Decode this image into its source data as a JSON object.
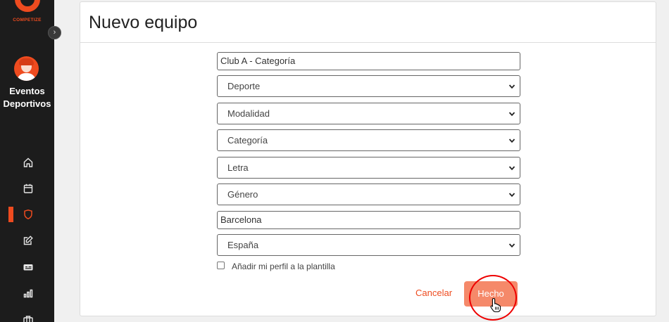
{
  "sidebar": {
    "logo_text": "COMPETIZE",
    "toggle_glyph": "›",
    "org_name": "Eventos Deportivos",
    "accent_color": "#ee4b1f",
    "nav_items": [
      {
        "icon": "home-icon",
        "active": false
      },
      {
        "icon": "calendar-icon",
        "active": false
      },
      {
        "icon": "shield-icon",
        "active": true
      },
      {
        "icon": "edit-icon",
        "active": false
      },
      {
        "icon": "ticket-icon",
        "active": false
      },
      {
        "icon": "stats-icon",
        "active": false
      },
      {
        "icon": "briefcase-icon",
        "active": false
      }
    ]
  },
  "card": {
    "title": "Nuevo equipo"
  },
  "form": {
    "team_name": "Club A - Categoría",
    "deporte": "Deporte",
    "modalidad": "Modalidad",
    "categoria": "Categoría",
    "letra": "Letra",
    "genero": "Género",
    "city": "Barcelona",
    "country": "España",
    "add_profile_label": "Añadir mi perfil a la plantilla",
    "cancel_label": "Cancelar",
    "done_label": "Hecho"
  }
}
